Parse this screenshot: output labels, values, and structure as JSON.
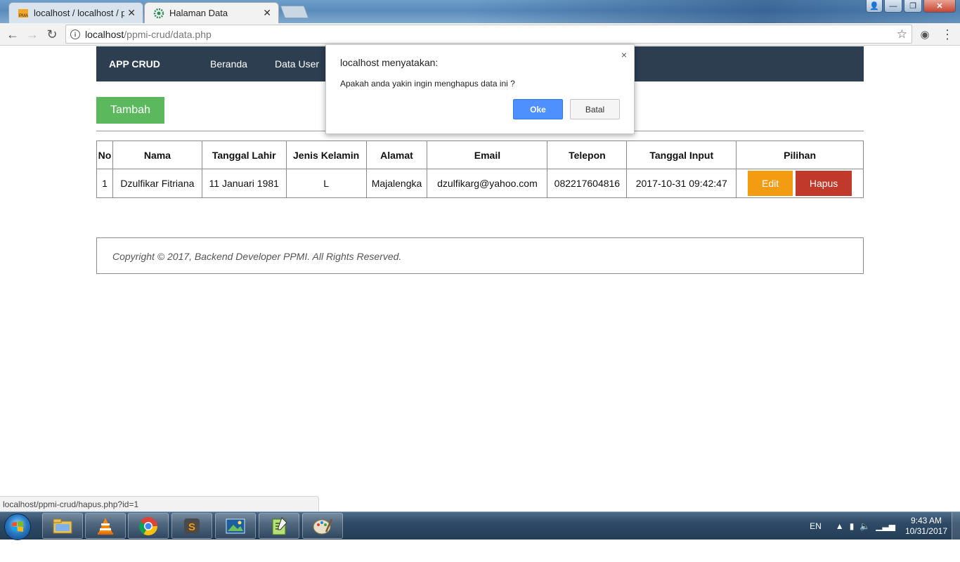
{
  "browser": {
    "tabs": [
      {
        "title": "localhost / localhost / pp",
        "favicon": "phpmyadmin-icon"
      },
      {
        "title": "Halaman Data",
        "favicon": "settings-gear-icon"
      }
    ],
    "url_host": "localhost",
    "url_path": "/ppmi-crud/data.php",
    "status_url": "localhost/ppmi-crud/hapus.php?id=1"
  },
  "app": {
    "brand": "APP CRUD",
    "nav": [
      "Beranda",
      "Data User"
    ],
    "add_button": "Tambah",
    "table": {
      "headers": [
        "No",
        "Nama",
        "Tanggal Lahir",
        "Jenis Kelamin",
        "Alamat",
        "Email",
        "Telepon",
        "Tanggal Input",
        "Pilihan"
      ],
      "rows": [
        {
          "no": "1",
          "nama": "Dzulfikar Fitriana",
          "tanggal_lahir": "11 Januari 1981",
          "jenis_kelamin": "L",
          "alamat": "Majalengka",
          "email": "dzulfikarg@yahoo.com",
          "telepon": "082217604816",
          "tanggal_input": "2017-10-31 09:42:47"
        }
      ],
      "edit_label": "Edit",
      "delete_label": "Hapus"
    },
    "footer": "Copyright © 2017, Backend Developer PPMI. All Rights Reserved."
  },
  "dialog": {
    "title": "localhost menyatakan:",
    "message": "Apakah anda yakin ingin menghapus data ini ?",
    "ok": "Oke",
    "cancel": "Batal",
    "close": "×"
  },
  "taskbar": {
    "lang": "EN",
    "time": "9:43 AM",
    "date": "10/31/2017",
    "apps": [
      "explorer-icon",
      "vlc-icon",
      "chrome-icon",
      "sublime-text-icon",
      "photo-viewer-icon",
      "notepad-plus-icon",
      "paint-icon"
    ]
  },
  "colors": {
    "navbar": "#2c3e50",
    "add_button": "#5cb85c",
    "edit_button": "#f39c12",
    "delete_button": "#c0392b",
    "dialog_ok": "#4d90fe"
  }
}
